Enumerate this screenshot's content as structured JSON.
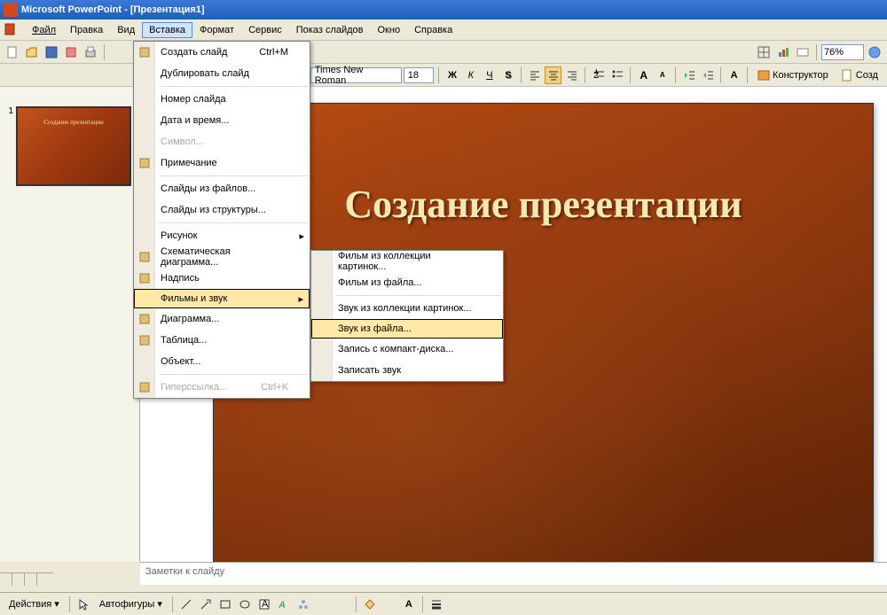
{
  "titlebar": {
    "app": "Microsoft PowerPoint",
    "doc": "[Презентация1]"
  },
  "menubar": {
    "items": [
      "Файл",
      "Правка",
      "Вид",
      "Вставка",
      "Формат",
      "Сервис",
      "Показ слайдов",
      "Окно",
      "Справка"
    ],
    "active_index": 3
  },
  "toolbar1": {
    "zoom": "76%"
  },
  "toolbar2": {
    "font_name": "Times New Roman",
    "font_size": "18",
    "designer_label": "Конструктор",
    "new_slide_label": "Созд"
  },
  "insert_menu": {
    "items": [
      {
        "label": "Создать слайд",
        "shortcut": "Ctrl+M",
        "icon": "new-slide-icon"
      },
      {
        "label": "Дублировать слайд"
      },
      {
        "sep": true
      },
      {
        "label": "Номер слайда"
      },
      {
        "label": "Дата и время..."
      },
      {
        "label": "Символ...",
        "disabled": true
      },
      {
        "label": "Примечание",
        "icon": "comment-icon"
      },
      {
        "sep": true
      },
      {
        "label": "Слайды из файлов..."
      },
      {
        "label": "Слайды из структуры..."
      },
      {
        "sep": true
      },
      {
        "label": "Рисунок",
        "submenu": true
      },
      {
        "label": "Схематическая диаграмма...",
        "icon": "diagram-icon"
      },
      {
        "label": "Надпись",
        "icon": "textbox-icon"
      },
      {
        "label": "Фильмы и звук",
        "submenu": true,
        "highlighted": true
      },
      {
        "label": "Диаграмма...",
        "icon": "chart-icon"
      },
      {
        "label": "Таблица...",
        "icon": "table-icon"
      },
      {
        "label": "Объект..."
      },
      {
        "sep": true
      },
      {
        "label": "Гиперссылка...",
        "shortcut": "Ctrl+K",
        "icon": "hyperlink-icon",
        "disabled": true
      }
    ]
  },
  "submenu": {
    "items": [
      {
        "label": "Фильм из коллекции картинок..."
      },
      {
        "label": "Фильм из файла..."
      },
      {
        "sep": true
      },
      {
        "label": "Звук из коллекции картинок..."
      },
      {
        "label": "Звук из файла...",
        "highlighted": true
      },
      {
        "label": "Запись с компакт-диска..."
      },
      {
        "label": "Записать звук"
      }
    ]
  },
  "slide": {
    "number": "1",
    "title": "Создание презентации",
    "thumb_title": "Создание презентации"
  },
  "notes": {
    "placeholder": "Заметки к слайду"
  },
  "drawing_toolbar": {
    "actions_label": "Действия",
    "autoshapes_label": "Автофигуры"
  }
}
